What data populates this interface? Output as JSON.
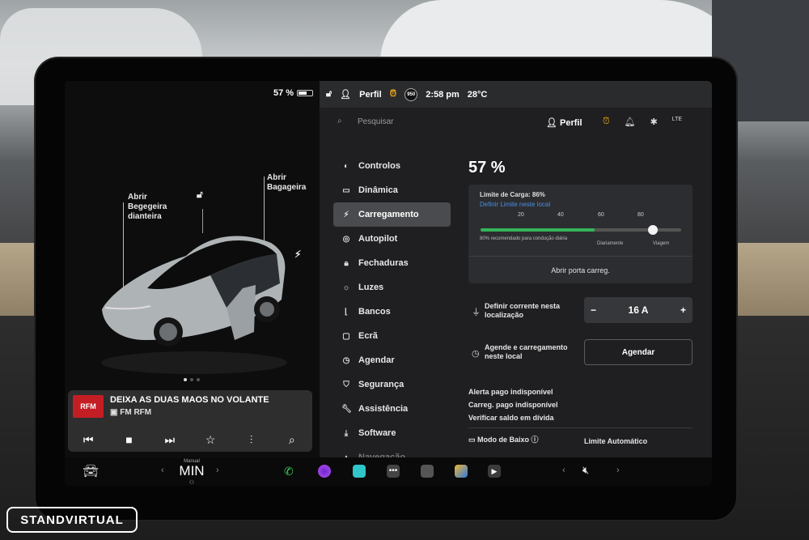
{
  "left": {
    "battery": "57 %",
    "callouts": {
      "frunk": "Abrir\nBegegeira\ndianteira",
      "trunk": "Abrir\nBagageira"
    },
    "media": {
      "logo": "RFM",
      "title": "DEIXA AS DUAS MAOS NO VOLANTE",
      "station": "FM RFM"
    }
  },
  "statusbar": {
    "profile": "Perfil",
    "badge": "950",
    "time": "2:58 pm",
    "temp": "28°C"
  },
  "search": {
    "placeholder": "Pesquisar"
  },
  "header": {
    "profile": "Perfil",
    "lte": "LTE"
  },
  "nav": [
    {
      "label": "Controlos",
      "icon": "toggle-icon"
    },
    {
      "label": "Dinâmica",
      "icon": "car-icon"
    },
    {
      "label": "Carregamento",
      "icon": "bolt-icon"
    },
    {
      "label": "Autopilot",
      "icon": "steering-wheel-icon"
    },
    {
      "label": "Fechaduras",
      "icon": "lock-icon"
    },
    {
      "label": "Luzes",
      "icon": "sun-icon"
    },
    {
      "label": "Bancos",
      "icon": "seat-icon"
    },
    {
      "label": "Ecrã",
      "icon": "screen-icon"
    },
    {
      "label": "Agendar",
      "icon": "clock-icon"
    },
    {
      "label": "Segurança",
      "icon": "shield-icon"
    },
    {
      "label": "Assistência",
      "icon": "wrench-icon"
    },
    {
      "label": "Software",
      "icon": "download-icon"
    },
    {
      "label": "Navegação",
      "icon": "navigation-icon"
    }
  ],
  "charging": {
    "percent": "57 %",
    "limit_label": "Limite de Carga: 86%",
    "limit_link": "Definir Limite neste local",
    "ticks": [
      "20",
      "40",
      "60",
      "80"
    ],
    "current_charge": 0.57,
    "charge_limit": 0.86,
    "note": "80% recomendado para condução diária",
    "daily": "Diariamente",
    "trip": "Viagem",
    "open_port": "Abrir porta carreg.",
    "set_current": "Definir corrente nesta\nlocalização",
    "current_value": "16 A",
    "minus": "−",
    "plus": "+",
    "schedule_label": "Agende e carregamento\nneste local",
    "schedule_button": "Agendar",
    "alerts": [
      "Alerta pago indisponível",
      "Carreg. pago indisponível",
      "Verificar saldo em dívida"
    ],
    "low_mode": "Modo de Baixo",
    "auto_limit": "Limite Automático"
  },
  "dock": {
    "gear_top": "Manual",
    "gear": "MIN"
  },
  "watermark": "STANDVIRTUAL"
}
